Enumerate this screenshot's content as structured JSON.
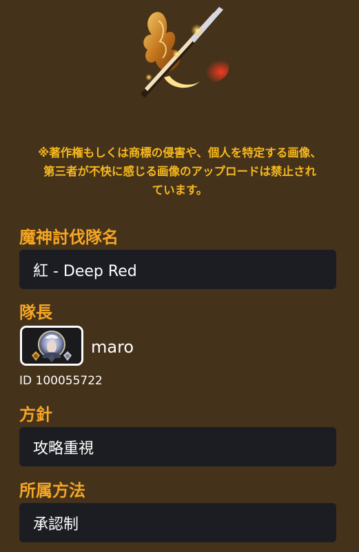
{
  "emblem": {
    "icon": "crossed-swords-flame-emblem-icon"
  },
  "notice": {
    "lines": [
      "※著作権もしくは商標の侵害や、個人を特定する画像、",
      "第三者が不快に感じる画像のアップロードは禁止され",
      "ています。"
    ]
  },
  "team_name": {
    "label": "魔神討伐隊名",
    "value": "紅 - Deep Red"
  },
  "leader": {
    "label": "隊長",
    "name": "maro",
    "id": "ID 100055722",
    "avatar_icon": "character-avatar-icon"
  },
  "policy": {
    "label": "方針",
    "value": "攻略重視"
  },
  "join_method": {
    "label": "所属方法",
    "value": "承認制"
  },
  "colors": {
    "background": "#45321b",
    "accent_orange": "#f5a623",
    "notice_yellow": "#f6b81e",
    "field_bg": "#1c1d22"
  }
}
